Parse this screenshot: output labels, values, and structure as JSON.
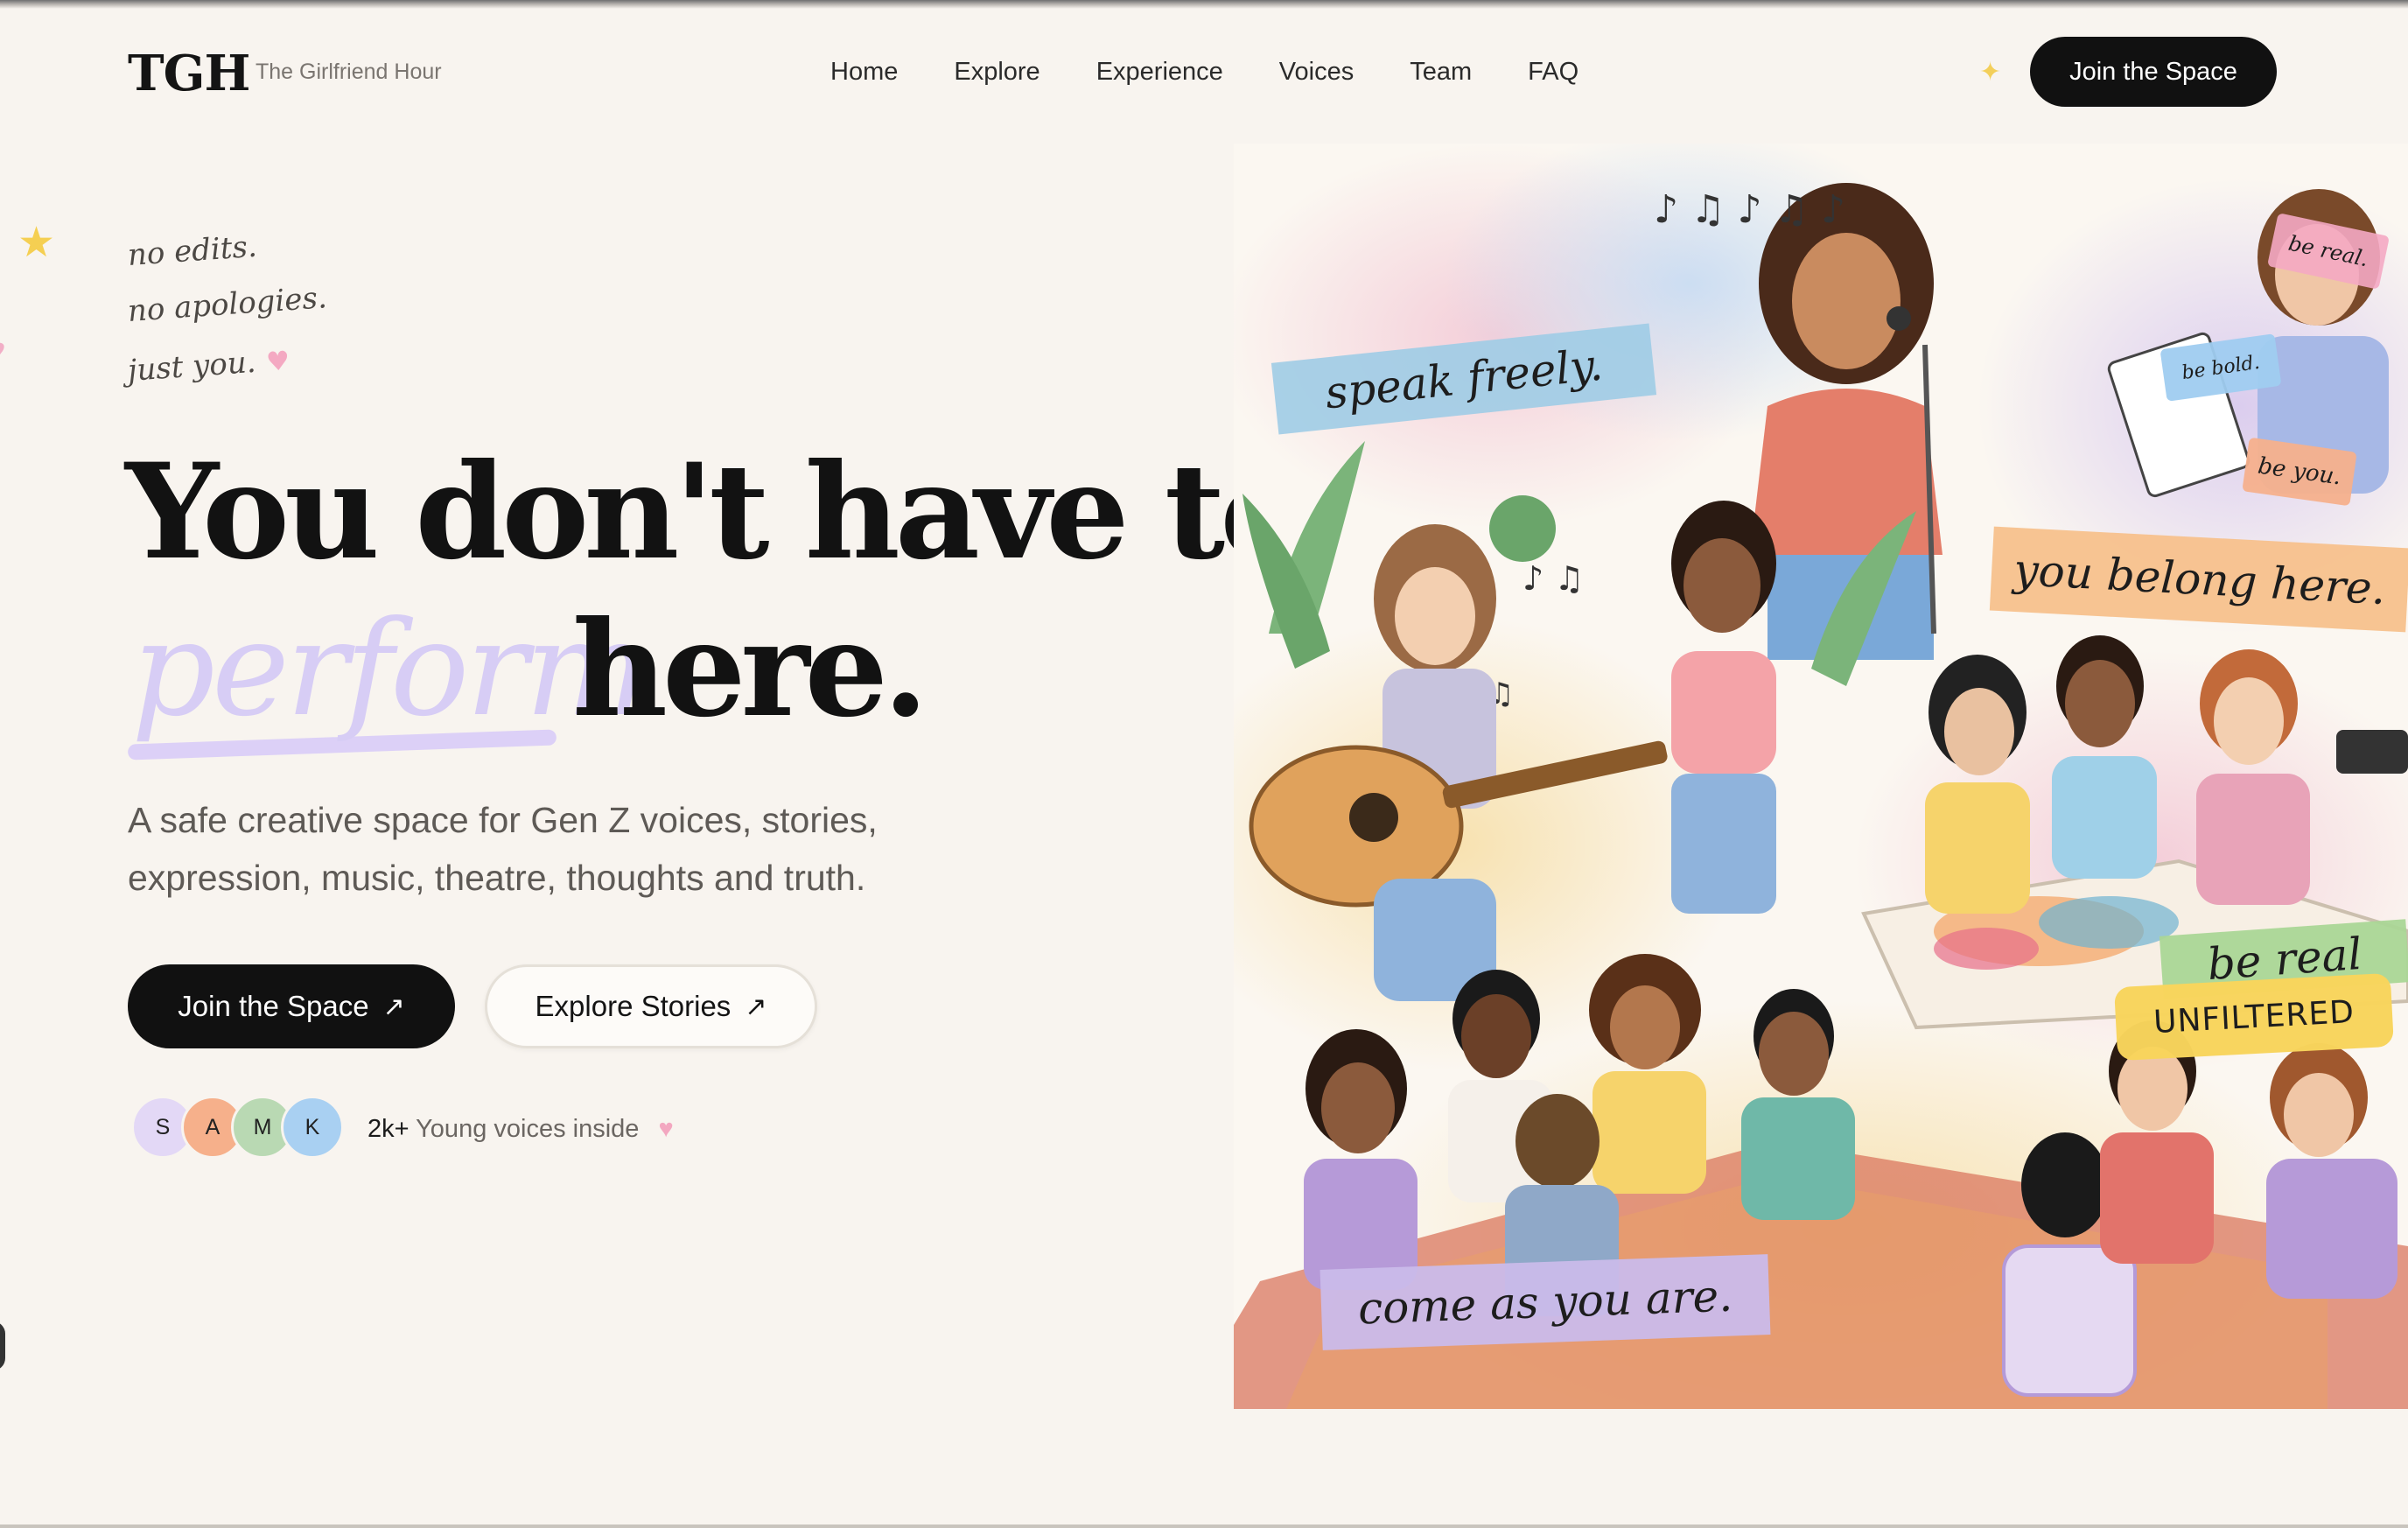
{
  "brand": {
    "mark": "TGH",
    "name": "The Girlfriend Hour"
  },
  "nav": {
    "items": [
      "Home",
      "Explore",
      "Experience",
      "Voices",
      "Team",
      "FAQ"
    ],
    "cta": "Join the Space"
  },
  "hero": {
    "taglines": [
      "no edits.",
      "no apologies.",
      "just you."
    ],
    "headline_line1": "You don't have to",
    "headline_accent": "perform",
    "headline_line2": "here.",
    "subtitle_line1": "A safe creative space for Gen Z voices, stories,",
    "subtitle_line2": "expression, music, theatre, thoughts and truth.",
    "primary_cta": "Join the Space",
    "secondary_cta": "Explore Stories",
    "arrow": "↗",
    "avatars": [
      {
        "initial": "S",
        "color": "#e3d8f6"
      },
      {
        "initial": "A",
        "color": "#f6b08b"
      },
      {
        "initial": "M",
        "color": "#b9d9b3"
      },
      {
        "initial": "K",
        "color": "#a9d0f2"
      }
    ],
    "community_count": "2k+",
    "community_label": "Young voices inside"
  },
  "illustration": {
    "labels": [
      "speak freely.",
      "be real.",
      "be bold.",
      "be you.",
      "you belong here.",
      "be real",
      "UNFILTERED",
      "come as you are."
    ],
    "palette": {
      "dark": "#111111",
      "accent_lilac": "#d7cdf5",
      "heart_pink": "#f3a7c0",
      "star_yellow": "#f5cf52"
    }
  }
}
